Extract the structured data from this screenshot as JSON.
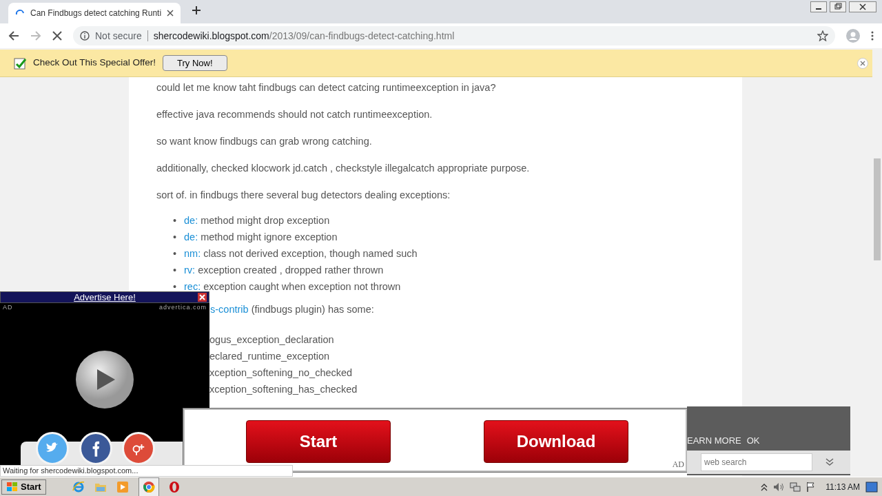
{
  "browser": {
    "tab": {
      "title": "Can Findbugs detect catching Runti",
      "loading": true
    },
    "address": {
      "security": "Not secure",
      "host": "shercodewiki.blogspot.com",
      "path": "/2013/09/can-findbugs-detect-catching.html"
    }
  },
  "infobar": {
    "message": "Check Out This Special Offer!",
    "button": "Try Now!"
  },
  "article": {
    "paragraphs": [
      "could let me know taht findbugs can detect catcing runtimeexception in java?",
      "effective java recommends should not catch runtimeexception.",
      "so want know findbugs can grab wrong catching.",
      "additionally, checked klocwork jd.catch , checkstyle illegalcatch appropriate purpose.",
      "sort of. in findbugs there several bug detectors dealing exceptions:"
    ],
    "detectors": [
      {
        "bullet": "•",
        "code": "de:",
        "text": "method might drop exception"
      },
      {
        "bullet": "•",
        "code": "de:",
        "text": "method might ignore exception"
      },
      {
        "bullet": "•",
        "code": "nm:",
        "text": "class not derived exception, though named such"
      },
      {
        "bullet": "•",
        "code": "rv:",
        "text": "exception created , dropped rather thrown"
      },
      {
        "bullet": "•",
        "code": "rec:",
        "text": "exception caught when exception not thrown"
      }
    ],
    "plugin_line": {
      "link": "s-contrib",
      "text": "(findbugs plugin) has some:"
    },
    "plugin_detectors": [
      "ogus_exception_declaration",
      "eclared_runtime_exception",
      "xception_softening_no_checked",
      "xception_softening_has_checked"
    ]
  },
  "video_ad": {
    "header": "Advertise Here!",
    "label": "AD",
    "source": "advertica.com"
  },
  "bottom_ad": {
    "buttons": [
      "Start",
      "Download"
    ],
    "label": "AD"
  },
  "cookie_bar": {
    "learn_more": "EARN MORE",
    "ok": "OK",
    "search_placeholder": "web search"
  },
  "status": "Waiting for shercodewiki.blogspot.com...",
  "taskbar": {
    "start": "Start",
    "clock": "11:13 AM"
  }
}
